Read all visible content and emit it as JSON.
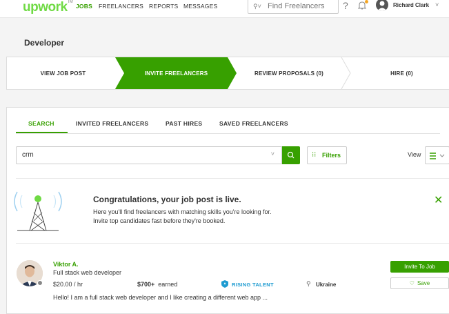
{
  "header": {
    "logo": "upwork",
    "logo_tm": "TM",
    "nav": [
      "JOBS",
      "FREELANCERS",
      "REPORTS",
      "MESSAGES"
    ],
    "search_placeholder": "Find Freelancers",
    "help": "?",
    "user_name": "Richard Clark"
  },
  "page_title": "Developer",
  "steps": [
    "VIEW JOB POST",
    "INVITE FREELANCERS",
    "REVIEW PROPOSALS (0)",
    "HIRE (0)"
  ],
  "tabs": [
    "SEARCH",
    "INVITED FREELANCERS",
    "PAST HIRES",
    "SAVED FREELANCERS"
  ],
  "search": {
    "value": "crm",
    "filters_label": "Filters",
    "view_label": "View"
  },
  "banner": {
    "title": "Congratulations, your job post is live.",
    "line1": "Here you'll find freelancers with matching skills you're looking for.",
    "line2": "Invite top candidates fast before they're booked."
  },
  "freelancer": {
    "name": "Viktor A.",
    "title": "Full stack web developer",
    "rate": "$20.00 / hr",
    "earned_amount": "$700+",
    "earned_label": "earned",
    "badge": "RISING TALENT",
    "location": "Ukraine",
    "description": "Hello! I am a full stack web developer and I like creating a different web app ...",
    "invite_label": "Invite To Job",
    "save_label": "Save"
  },
  "colors": {
    "brand_green": "#37a000",
    "logo_green": "#6fda44",
    "badge_blue": "#1d9bd1"
  }
}
